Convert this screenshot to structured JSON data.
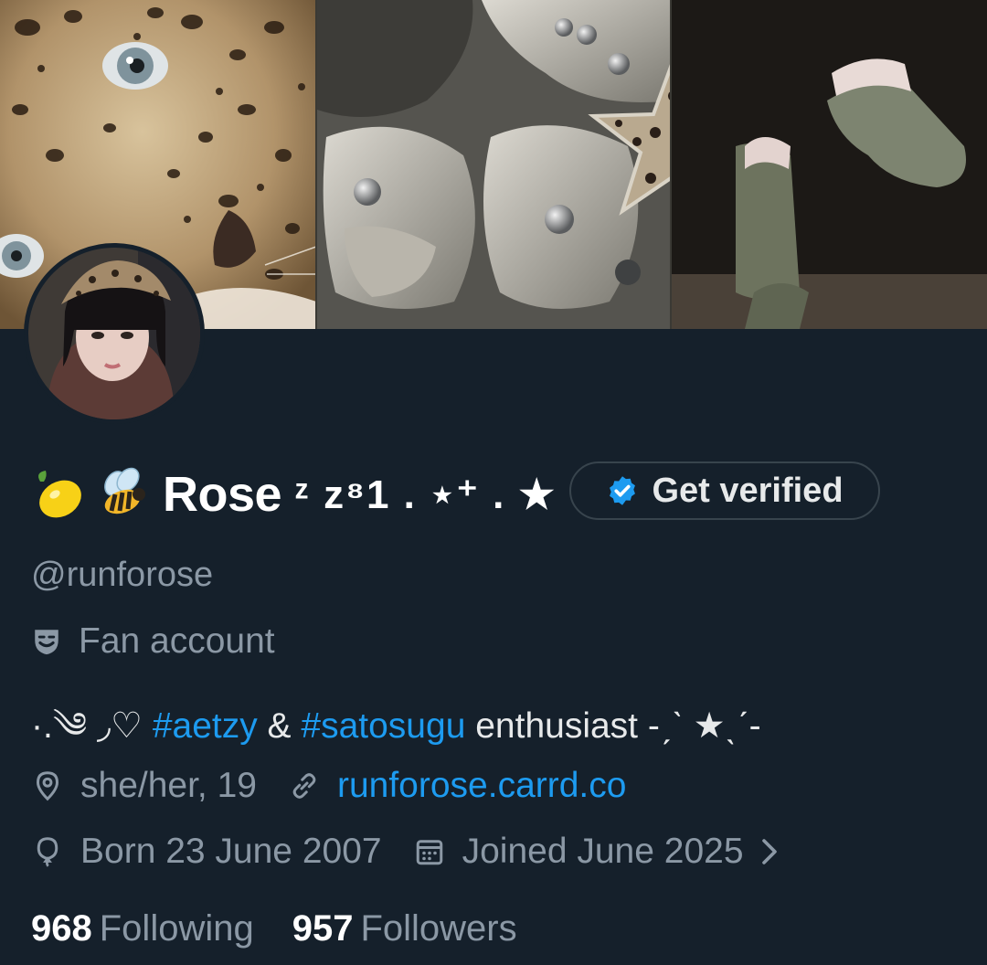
{
  "profile": {
    "display_name": "Rose",
    "name_decoration": "ᶻ z⁸1 . ⋆⁺ . ★",
    "handle": "@runforose",
    "verify_label": "Get verified"
  },
  "category": {
    "label": "Fan account",
    "icon": "theater-masks-icon"
  },
  "bio": {
    "prefix": "·.༄ ◞♡ ",
    "hashtag1": "#aetzy",
    "connector": " & ",
    "hashtag2": "#satosugu",
    "suffix": " enthusiast -ˏˋ ★ˎˊ-"
  },
  "meta": {
    "location": "she/her, 19",
    "website": "runforose.carrd.co",
    "birthday": "Born 23 June 2007",
    "joined": "Joined June 2025"
  },
  "stats": {
    "following_count": "968",
    "following_label": "Following",
    "followers_count": "957",
    "followers_label": "Followers"
  },
  "colors": {
    "background": "#15202b",
    "accent": "#1d9bf0",
    "secondary_text": "#8b98a5",
    "verified_badge": "#1d9bf0"
  }
}
